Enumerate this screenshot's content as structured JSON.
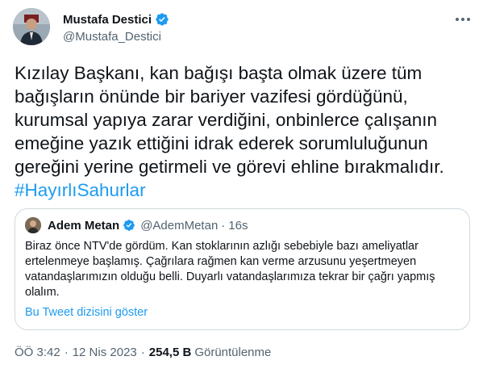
{
  "author": {
    "name": "Mustafa Destici",
    "handle": "@Mustafa_Destici"
  },
  "tweet": {
    "lines": [
      "Kızılay Başkanı, kan bağışı başta olmak üzere tüm",
      "bağışların önünde bir bariyer vazifesi gördüğünü,",
      "kurumsal yapıya zarar verdiğini, onbinlerce çalışanın",
      "emeğine yazık ettiğini idrak ederek sorumluluğunun",
      "gereğini yerine getirmeli ve görevi ehline bırakmalıdır."
    ],
    "hashtag": "#HayırlıSahurlar"
  },
  "quote": {
    "name": "Adem Metan",
    "handle": "@AdemMetan",
    "dot": "·",
    "time": "16s",
    "lines": [
      "Biraz önce NTV'de gördüm. Kan stoklarının azlığı sebebiyle bazı ameliyatlar",
      "ertelenmeye başlamış. Çağrılara rağmen kan verme arzusunu yeşertmeyen",
      "vatandaşlarımızın olduğu belli. Duyarlı vatandaşlarımıza tekrar bir çağrı yapmış",
      "olalım."
    ],
    "show_thread": "Bu Tweet dizisini göster"
  },
  "meta": {
    "time": "ÖÖ 3:42",
    "sep": "·",
    "date": "12 Nis 2023",
    "views_count": "254,5 B",
    "views_label": "Görüntülenme"
  },
  "colors": {
    "accent": "#1d9bf0",
    "text": "#0f1419",
    "secondary": "#536471",
    "border": "#cfd9de"
  },
  "icons": [
    "verified-badge-icon",
    "more-options-icon"
  ]
}
